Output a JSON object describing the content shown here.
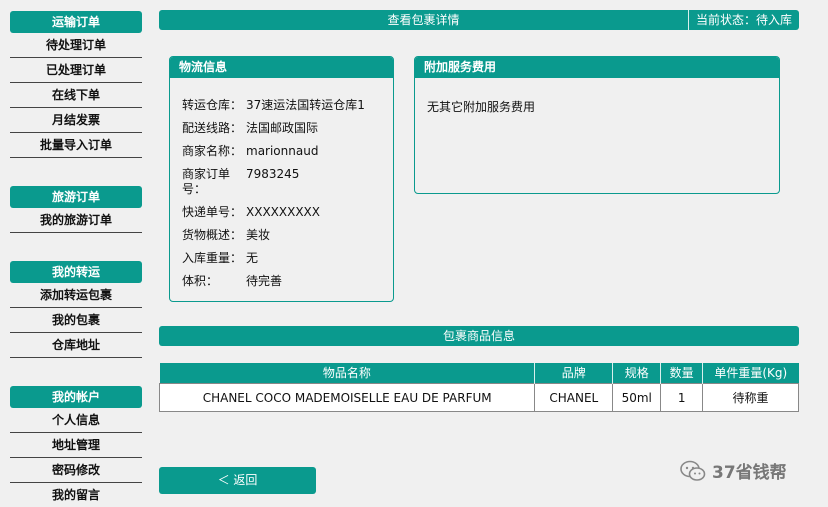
{
  "sidebar": {
    "groups": [
      {
        "title": "运输订单",
        "items": [
          "待处理订单",
          "已处理订单",
          "在线下单",
          "月结发票",
          "批量导入订单"
        ]
      },
      {
        "title": "旅游订单",
        "items": [
          "我的旅游订单"
        ]
      },
      {
        "title": "我的转运",
        "items": [
          "添加转运包裹",
          "我的包裹",
          "仓库地址"
        ]
      },
      {
        "title": "我的帐户",
        "items": [
          "个人信息",
          "地址管理",
          "密码修改",
          "我的留言"
        ]
      }
    ]
  },
  "header": {
    "title": "查看包裹详情",
    "status": "当前状态：待入库"
  },
  "logistics": {
    "title": "物流信息",
    "rows": [
      {
        "label": "转运仓库：",
        "value": "37速运法国转运仓库1"
      },
      {
        "label": "配送线路：",
        "value": "法国邮政国际"
      },
      {
        "label": "商家名称：",
        "value": "marionnaud"
      },
      {
        "label": "商家订单\n号：",
        "value": "7983245"
      },
      {
        "label": "快递单号：",
        "value": "XXXXXXXXX"
      },
      {
        "label": "货物概述：",
        "value": "美妆"
      },
      {
        "label": "入库重量：",
        "value": "无"
      },
      {
        "label": "体积：",
        "value": "待完善"
      }
    ]
  },
  "extra_fees": {
    "title": "附加服务费用",
    "text": "无其它附加服务费用"
  },
  "goods": {
    "title": "包裹商品信息",
    "columns": [
      "物品名称",
      "品牌",
      "规格",
      "数量",
      "单件重量(Kg)"
    ],
    "rows": [
      [
        "CHANEL COCO MADEMOISELLE EAU DE PARFUM",
        "CHANEL",
        "50ml",
        "1",
        "待称重"
      ]
    ]
  },
  "back_label": "＜ 返回",
  "watermark": "37省钱帮",
  "colors": {
    "accent": "#0a9a8e"
  }
}
